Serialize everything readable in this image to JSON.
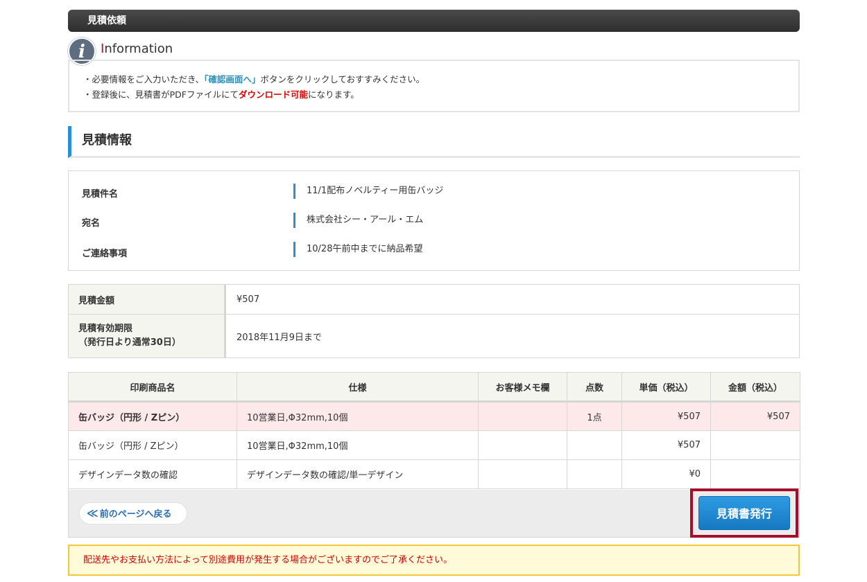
{
  "header": {
    "title": "見積依頼"
  },
  "information": {
    "heading_first": "I",
    "heading_rest": "nformation",
    "line1": {
      "prefix": "・必要情報をご入力いただき、",
      "highlight": "「確認画面へ」",
      "suffix": "ボタンをクリックしておすすみください。"
    },
    "line2": {
      "prefix": "・登録後に、見積書がPDFファイルにて",
      "highlight": "ダウンロード可能",
      "suffix": "になります。"
    }
  },
  "section": {
    "title": "見積情報"
  },
  "details": [
    {
      "label": "見積件名",
      "value": "11/1配布ノベルティー用缶バッジ"
    },
    {
      "label": "宛名",
      "value": "株式会社シー・アール・エム"
    },
    {
      "label": "ご連絡事項",
      "value": "10/28午前中までに納品希望"
    }
  ],
  "amount": {
    "total_label": "見積金額",
    "total_value": "¥507",
    "expiry_label_line1": "見積有効期限",
    "expiry_label_line2": "（発行日より通常30日）",
    "expiry_value": "2018年11月9日まで"
  },
  "table": {
    "headers": [
      "印刷商品名",
      "仕様",
      "お客様メモ欄",
      "点数",
      "単価（税込）",
      "金額（税込）"
    ],
    "rows": [
      {
        "name": "缶バッジ（円形 / Zピン）",
        "spec": "10営業日,Φ32mm,10個",
        "memo": "",
        "qty": "1点",
        "unit": "¥507",
        "amount": "¥507"
      },
      {
        "name": "缶バッジ（円形 / Zピン）",
        "spec": "10営業日,Φ32mm,10個",
        "memo": "",
        "qty": "",
        "unit": "¥507",
        "amount": ""
      },
      {
        "name": "デザインデータ数の確認",
        "spec": "デザインデータ数の確認/単一デザイン",
        "memo": "",
        "qty": "",
        "unit": "¥0",
        "amount": ""
      }
    ]
  },
  "actions": {
    "back_label": "前のページへ戻る",
    "back_chevron": "≪",
    "issue_label": "見積書発行"
  },
  "notice": {
    "text": "配送先やお支払い方法によって別途費用が発生する場合がございますのでご了承ください。"
  }
}
